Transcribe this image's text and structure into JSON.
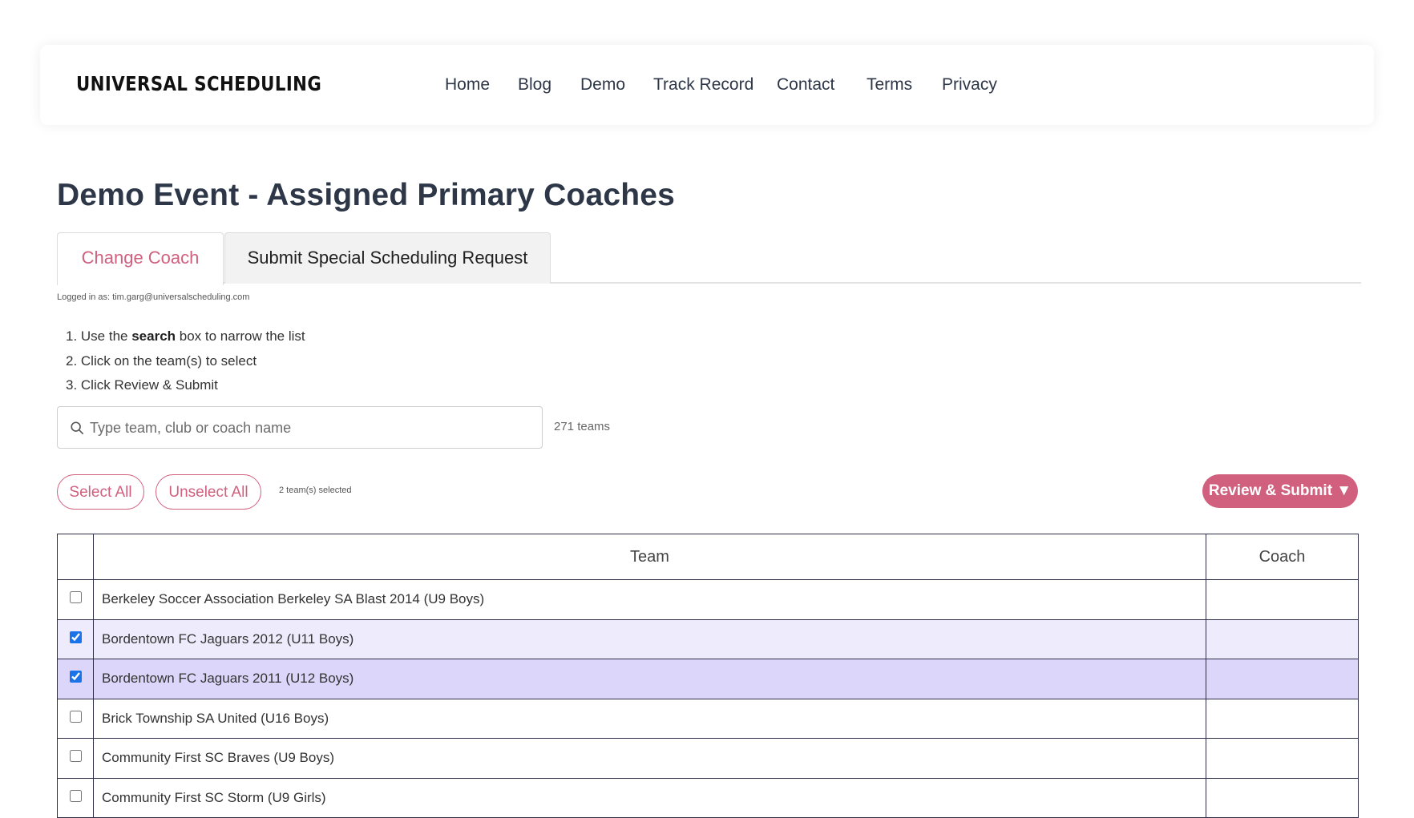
{
  "header": {
    "logo": "UNIVERSAL SCHEDULING",
    "nav": [
      "Home",
      "Blog",
      "Demo",
      "Track Record",
      "Contact",
      "Terms",
      "Privacy"
    ]
  },
  "page": {
    "title": "Demo Event - Assigned Primary Coaches",
    "tabs": [
      "Change Coach",
      "Submit Special Scheduling Request"
    ],
    "active_tab": "Change Coach",
    "logged_in": "Logged in as: tim.garg@universalscheduling.com",
    "steps": {
      "step1_prefix": "1. Use the ",
      "step1_bold": "search",
      "step1_suffix": " box to narrow the list",
      "step2": "2. Click on the team(s) to select",
      "step3": "3. Click Review & Submit"
    },
    "search": {
      "placeholder": "Type team, club or coach name",
      "value": ""
    },
    "team_count": "271 teams",
    "select_all": "Select All",
    "unselect_all": "Unselect All",
    "selected_count": "2 team(s) selected",
    "review_submit": "Review & Submit ▼"
  },
  "table": {
    "headers": {
      "team": "Team",
      "coach": "Coach"
    },
    "rows": [
      {
        "team": "Berkeley Soccer Association Berkeley SA Blast 2014 (U9 Boys)",
        "coach": "",
        "checked": false
      },
      {
        "team": "Bordentown FC Jaguars 2012 (U11 Boys)",
        "coach": "",
        "checked": true
      },
      {
        "team": "Bordentown FC Jaguars 2011 (U12 Boys)",
        "coach": "",
        "checked": true
      },
      {
        "team": "Brick Township SA United (U16 Boys)",
        "coach": "",
        "checked": false
      },
      {
        "team": "Community First SC Braves (U9 Boys)",
        "coach": "",
        "checked": false
      },
      {
        "team": "Community First SC Storm (U9 Girls)",
        "coach": "",
        "checked": false
      }
    ]
  },
  "colors": {
    "accent": "#d0607e",
    "text": "#2d3748",
    "selected_row": "#eeecfc",
    "selected_row_hover": "#dcd6fa"
  }
}
